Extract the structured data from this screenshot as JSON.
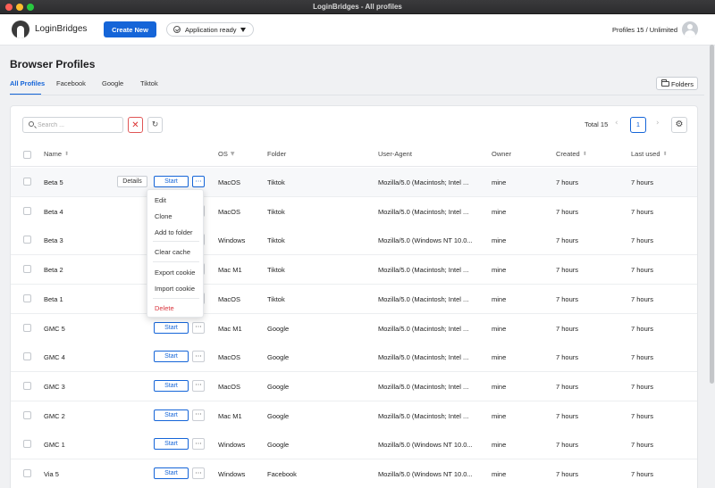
{
  "window": {
    "title": "LoginBridges - All profiles"
  },
  "header": {
    "brand": "LoginBridges",
    "create_label": "Create New",
    "status_label": "Application ready",
    "profiles_count": "Profiles 15 / Unlimited"
  },
  "page": {
    "title": "Browser Profiles",
    "tabs": [
      {
        "label": "All Profiles",
        "active": true
      },
      {
        "label": "Facebook"
      },
      {
        "label": "Google"
      },
      {
        "label": "Tiktok"
      }
    ],
    "folders_label": "Folders"
  },
  "toolbar": {
    "search_placeholder": "Search ...",
    "clear_glyph": "✕",
    "refresh_glyph": "↻",
    "total": "Total 15",
    "prev_glyph": "‹",
    "current_page": "1",
    "next_glyph": "›",
    "settings_glyph": "⚙"
  },
  "table": {
    "columns": {
      "name": "Name",
      "os": "OS",
      "folder": "Folder",
      "user_agent": "User-Agent",
      "owner": "Owner",
      "created": "Created",
      "last_used": "Last used"
    },
    "sort_glyph": "⬍",
    "filter_glyph": "▼",
    "start_label": "Start",
    "more_glyph": "···",
    "details_label": "Details",
    "rows": [
      {
        "name": "Beta 5",
        "os": "MacOS",
        "folder": "Tiktok",
        "ua": "Mozilla/5.0 (Macintosh; Intel ...",
        "owner": "mine",
        "created": "7 hours",
        "last_used": "7 hours"
      },
      {
        "name": "Beta 4",
        "os": "MacOS",
        "folder": "Tiktok",
        "ua": "Mozilla/5.0 (Macintosh; Intel ...",
        "owner": "mine",
        "created": "7 hours",
        "last_used": "7 hours"
      },
      {
        "name": "Beta 3",
        "os": "Windows",
        "folder": "Tiktok",
        "ua": "Mozilla/5.0 (Windows NT 10.0...",
        "owner": "mine",
        "created": "7 hours",
        "last_used": "7 hours"
      },
      {
        "name": "Beta 2",
        "os": "Mac M1",
        "folder": "Tiktok",
        "ua": "Mozilla/5.0 (Macintosh; Intel ...",
        "owner": "mine",
        "created": "7 hours",
        "last_used": "7 hours"
      },
      {
        "name": "Beta 1",
        "os": "MacOS",
        "folder": "Tiktok",
        "ua": "Mozilla/5.0 (Macintosh; Intel ...",
        "owner": "mine",
        "created": "7 hours",
        "last_used": "7 hours"
      },
      {
        "name": "GMC 5",
        "os": "Mac M1",
        "folder": "Google",
        "ua": "Mozilla/5.0 (Macintosh; Intel ...",
        "owner": "mine",
        "created": "7 hours",
        "last_used": "7 hours"
      },
      {
        "name": "GMC 4",
        "os": "MacOS",
        "folder": "Google",
        "ua": "Mozilla/5.0 (Macintosh; Intel ...",
        "owner": "mine",
        "created": "7 hours",
        "last_used": "7 hours"
      },
      {
        "name": "GMC 3",
        "os": "MacOS",
        "folder": "Google",
        "ua": "Mozilla/5.0 (Macintosh; Intel ...",
        "owner": "mine",
        "created": "7 hours",
        "last_used": "7 hours"
      },
      {
        "name": "GMC 2",
        "os": "Mac M1",
        "folder": "Google",
        "ua": "Mozilla/5.0 (Macintosh; Intel ...",
        "owner": "mine",
        "created": "7 hours",
        "last_used": "7 hours"
      },
      {
        "name": "GMC 1",
        "os": "Windows",
        "folder": "Google",
        "ua": "Mozilla/5.0 (Windows NT 10.0...",
        "owner": "mine",
        "created": "7 hours",
        "last_used": "7 hours"
      },
      {
        "name": "Via 5",
        "os": "Windows",
        "folder": "Facebook",
        "ua": "Mozilla/5.0 (Windows NT 10.0...",
        "owner": "mine",
        "created": "7 hours",
        "last_used": "7 hours"
      }
    ]
  },
  "context_menu": {
    "items": [
      "Edit",
      "Clone",
      "Add to folder",
      "Clear cache",
      "Export cookie",
      "Import cookie",
      "Delete"
    ]
  }
}
